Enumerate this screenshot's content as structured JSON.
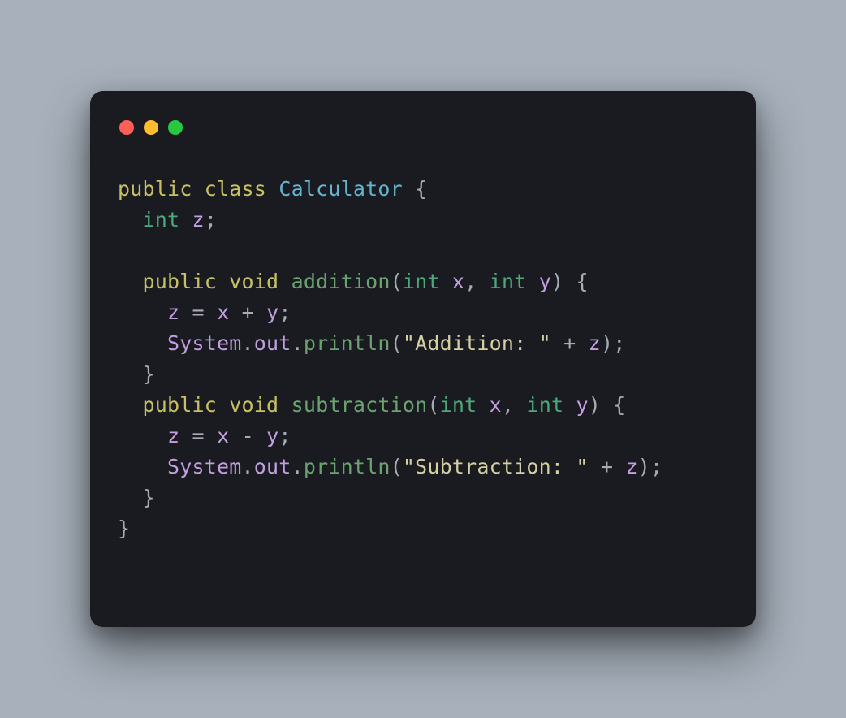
{
  "traffic_lights": {
    "red": "#ff5f56",
    "yellow": "#ffbd2e",
    "green": "#27c93f"
  },
  "code": {
    "tokens": [
      [
        [
          "public",
          "kw"
        ],
        [
          " ",
          "p"
        ],
        [
          "class",
          "kw"
        ],
        [
          " ",
          "p"
        ],
        [
          "Calculator",
          "class"
        ],
        [
          " ",
          "p"
        ],
        [
          "{",
          "punc"
        ]
      ],
      [
        [
          "  ",
          "p"
        ],
        [
          "int",
          "type"
        ],
        [
          " ",
          "p"
        ],
        [
          "z",
          "var"
        ],
        [
          ";",
          "punc"
        ]
      ],
      [],
      [
        [
          "  ",
          "p"
        ],
        [
          "public",
          "kw"
        ],
        [
          " ",
          "p"
        ],
        [
          "void",
          "kw"
        ],
        [
          " ",
          "p"
        ],
        [
          "addition",
          "fn"
        ],
        [
          "(",
          "punc"
        ],
        [
          "int",
          "type"
        ],
        [
          " ",
          "p"
        ],
        [
          "x",
          "var"
        ],
        [
          ",",
          "punc"
        ],
        [
          " ",
          "p"
        ],
        [
          "int",
          "type"
        ],
        [
          " ",
          "p"
        ],
        [
          "y",
          "var"
        ],
        [
          ")",
          "punc"
        ],
        [
          " ",
          "p"
        ],
        [
          "{",
          "punc"
        ]
      ],
      [
        [
          "    ",
          "p"
        ],
        [
          "z",
          "var"
        ],
        [
          " ",
          "p"
        ],
        [
          "=",
          "punc"
        ],
        [
          " ",
          "p"
        ],
        [
          "x",
          "var"
        ],
        [
          " ",
          "p"
        ],
        [
          "+",
          "punc"
        ],
        [
          " ",
          "p"
        ],
        [
          "y",
          "var"
        ],
        [
          ";",
          "punc"
        ]
      ],
      [
        [
          "    ",
          "p"
        ],
        [
          "System",
          "var"
        ],
        [
          ".",
          "punc"
        ],
        [
          "out",
          "var"
        ],
        [
          ".",
          "punc"
        ],
        [
          "println",
          "fn"
        ],
        [
          "(",
          "punc"
        ],
        [
          "\"Addition: \"",
          "str"
        ],
        [
          " ",
          "p"
        ],
        [
          "+",
          "punc"
        ],
        [
          " ",
          "p"
        ],
        [
          "z",
          "var"
        ],
        [
          ")",
          "punc"
        ],
        [
          ";",
          "punc"
        ]
      ],
      [
        [
          "  ",
          "p"
        ],
        [
          "}",
          "punc"
        ]
      ],
      [
        [
          "  ",
          "p"
        ],
        [
          "public",
          "kw"
        ],
        [
          " ",
          "p"
        ],
        [
          "void",
          "kw"
        ],
        [
          " ",
          "p"
        ],
        [
          "subtraction",
          "fn"
        ],
        [
          "(",
          "punc"
        ],
        [
          "int",
          "type"
        ],
        [
          " ",
          "p"
        ],
        [
          "x",
          "var"
        ],
        [
          ",",
          "punc"
        ],
        [
          " ",
          "p"
        ],
        [
          "int",
          "type"
        ],
        [
          " ",
          "p"
        ],
        [
          "y",
          "var"
        ],
        [
          ")",
          "punc"
        ],
        [
          " ",
          "p"
        ],
        [
          "{",
          "punc"
        ]
      ],
      [
        [
          "    ",
          "p"
        ],
        [
          "z",
          "var"
        ],
        [
          " ",
          "p"
        ],
        [
          "=",
          "punc"
        ],
        [
          " ",
          "p"
        ],
        [
          "x",
          "var"
        ],
        [
          " ",
          "p"
        ],
        [
          "-",
          "punc"
        ],
        [
          " ",
          "p"
        ],
        [
          "y",
          "var"
        ],
        [
          ";",
          "punc"
        ]
      ],
      [
        [
          "    ",
          "p"
        ],
        [
          "System",
          "var"
        ],
        [
          ".",
          "punc"
        ],
        [
          "out",
          "var"
        ],
        [
          ".",
          "punc"
        ],
        [
          "println",
          "fn"
        ],
        [
          "(",
          "punc"
        ],
        [
          "\"Subtraction: \"",
          "str"
        ],
        [
          " ",
          "p"
        ],
        [
          "+",
          "punc"
        ],
        [
          " ",
          "p"
        ],
        [
          "z",
          "var"
        ],
        [
          ")",
          "punc"
        ],
        [
          ";",
          "punc"
        ]
      ],
      [
        [
          "  ",
          "p"
        ],
        [
          "}",
          "punc"
        ]
      ],
      [
        [
          "}",
          "punc"
        ]
      ]
    ]
  }
}
